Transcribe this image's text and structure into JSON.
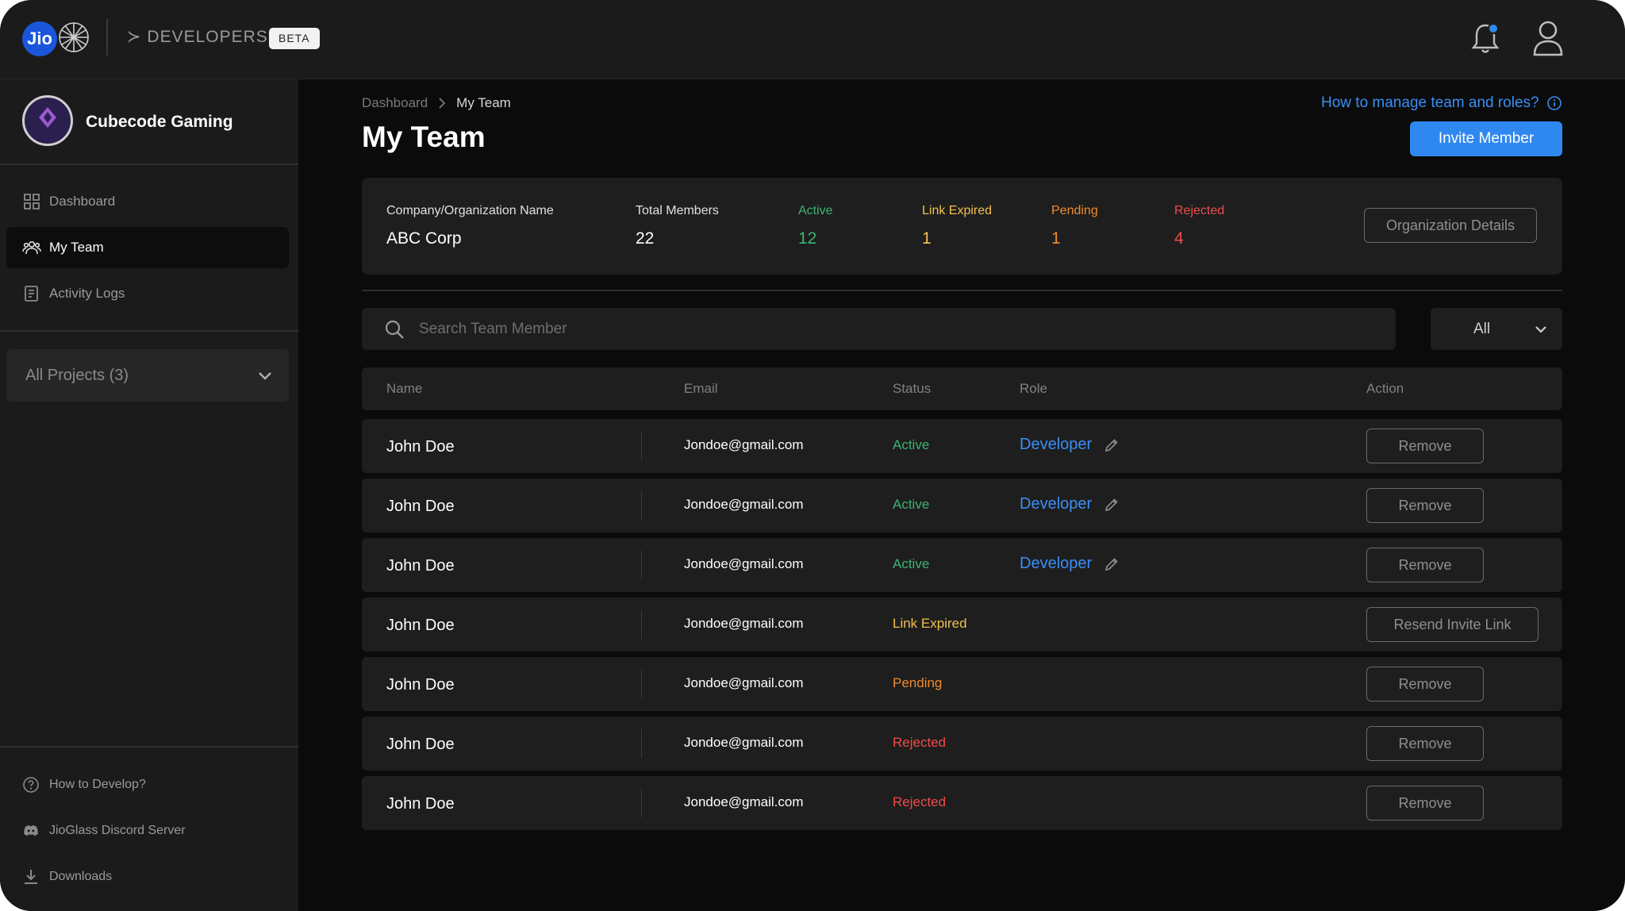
{
  "colors": {
    "active": "#3cb371",
    "link_expired": "#f2c14e",
    "pending": "#f08a2e",
    "rejected": "#ef4b4b",
    "accent": "#2f88f0"
  },
  "header": {
    "logo_text": "Jio",
    "brand": "≻ DEVELOPERS",
    "badge": "BETA"
  },
  "sidebar": {
    "org_name": "Cubecode Gaming",
    "nav": [
      {
        "label": "Dashboard",
        "icon": "grid-icon"
      },
      {
        "label": "My Team",
        "icon": "team-icon"
      },
      {
        "label": "Activity Logs",
        "icon": "log-icon"
      }
    ],
    "projects_label": "All Projects (3)",
    "footer": [
      {
        "label": "How to Develop?",
        "icon": "help-circle-icon"
      },
      {
        "label": "JioGlass Discord Server",
        "icon": "discord-icon"
      },
      {
        "label": "Downloads",
        "icon": "download-icon"
      }
    ]
  },
  "main": {
    "breadcrumb": [
      "Dashboard",
      "My Team"
    ],
    "title": "My Team",
    "help_link": "How to manage team and roles?",
    "invite_label": "Invite Member",
    "summary": {
      "org_label": "Company/Organization Name",
      "org_value": "ABC Corp",
      "total_label": "Total Members",
      "total_value": "22",
      "active_label": "Active",
      "active_value": "12",
      "expired_label": "Link Expired",
      "expired_value": "1",
      "pending_label": "Pending",
      "pending_value": "1",
      "rejected_label": "Rejected",
      "rejected_value": "4",
      "details_button": "Organization Details"
    },
    "search_placeholder": "Search Team Member",
    "filter_value": "All",
    "columns": [
      "Name",
      "Email",
      "Status",
      "Role",
      "Action"
    ],
    "rows": [
      {
        "name": "John Doe",
        "email": "Jondoe@gmail.com",
        "status": "Active",
        "role": "Developer",
        "action": "Remove"
      },
      {
        "name": "John Doe",
        "email": "Jondoe@gmail.com",
        "status": "Active",
        "role": "Developer",
        "action": "Remove"
      },
      {
        "name": "John Doe",
        "email": "Jondoe@gmail.com",
        "status": "Active",
        "role": "Developer",
        "action": "Remove"
      },
      {
        "name": "John Doe",
        "email": "Jondoe@gmail.com",
        "status": "Link Expired",
        "role": "",
        "action": "Resend Invite Link"
      },
      {
        "name": "John Doe",
        "email": "Jondoe@gmail.com",
        "status": "Pending",
        "role": "",
        "action": "Remove"
      },
      {
        "name": "John Doe",
        "email": "Jondoe@gmail.com",
        "status": "Rejected",
        "role": "",
        "action": "Remove"
      },
      {
        "name": "John Doe",
        "email": "Jondoe@gmail.com",
        "status": "Rejected",
        "role": "",
        "action": "Remove"
      }
    ]
  }
}
